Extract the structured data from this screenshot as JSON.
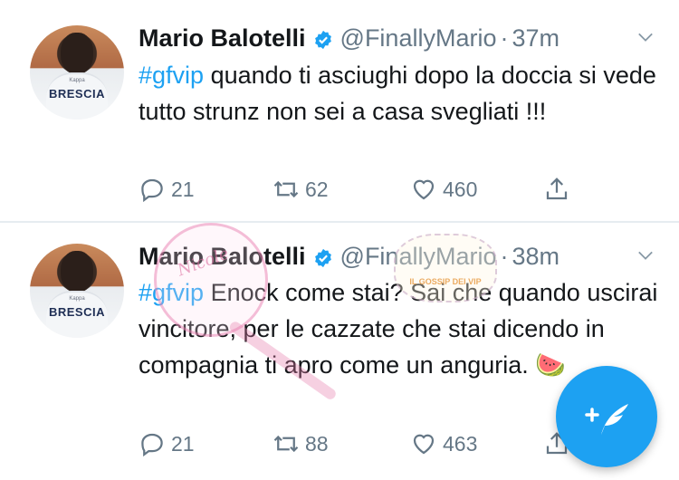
{
  "tweets": [
    {
      "author": {
        "name": "Mario Balotelli",
        "handle": "@FinallyMario",
        "avatar_logo": "BRESCIA",
        "avatar_sublogo": "Kappa"
      },
      "separator": "·",
      "time": "37m",
      "text": {
        "hashtag": "#gfvip",
        "body": " quando ti asciughi dopo la doccia si vede tutto strunz non sei a casa svegliati !!!"
      },
      "counts": {
        "replies": "21",
        "retweets": "62",
        "likes": "460"
      }
    },
    {
      "author": {
        "name": "Mario Balotelli",
        "handle": "@FinallyMario",
        "avatar_logo": "BRESCIA",
        "avatar_sublogo": "Kappa"
      },
      "separator": "·",
      "time": "38m",
      "text": {
        "hashtag": "#gfvip",
        "body": " Enock come stai? Sai che quando uscirai vincitore, per le cazzate che stai dicendo in compagnia ti apro come un anguria. 🍉"
      },
      "counts": {
        "replies": "21",
        "retweets": "88",
        "likes": "463"
      }
    }
  ],
  "overlays": {
    "watermark_text": "Nicole",
    "sticker_text": "IL GOSSIP DEI VIP"
  },
  "icons": {
    "verified": "verified-badge-icon",
    "chevron": "chevron-down-icon",
    "reply": "reply-icon",
    "retweet": "retweet-icon",
    "like": "heart-icon",
    "share": "share-icon",
    "compose": "compose-tweet-icon"
  },
  "colors": {
    "accent": "#1da1f2",
    "text": "#14171a",
    "secondary": "#657786",
    "divider": "#e6ecf0"
  }
}
